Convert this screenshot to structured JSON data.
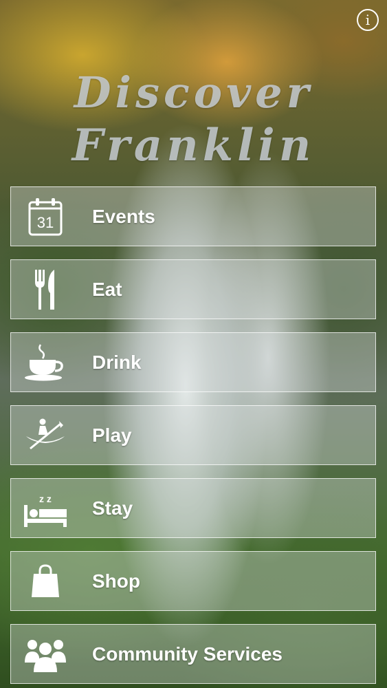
{
  "app": {
    "title_line1": "Discover",
    "title_line2": "Franklin",
    "info_label": "i"
  },
  "menu": {
    "items": [
      {
        "label": "Events",
        "icon": "calendar-icon",
        "calendar_day": "31"
      },
      {
        "label": "Eat",
        "icon": "fork-knife-icon"
      },
      {
        "label": "Drink",
        "icon": "coffee-cup-icon"
      },
      {
        "label": "Play",
        "icon": "kayak-icon"
      },
      {
        "label": "Stay",
        "icon": "bed-sleep-icon",
        "sleep_text": "z z"
      },
      {
        "label": "Shop",
        "icon": "shopping-bag-icon"
      },
      {
        "label": "Community Services",
        "icon": "people-group-icon"
      }
    ]
  },
  "colors": {
    "text": "#ffffff",
    "tile_border": "#ffffff",
    "title": "#c8ced2"
  }
}
